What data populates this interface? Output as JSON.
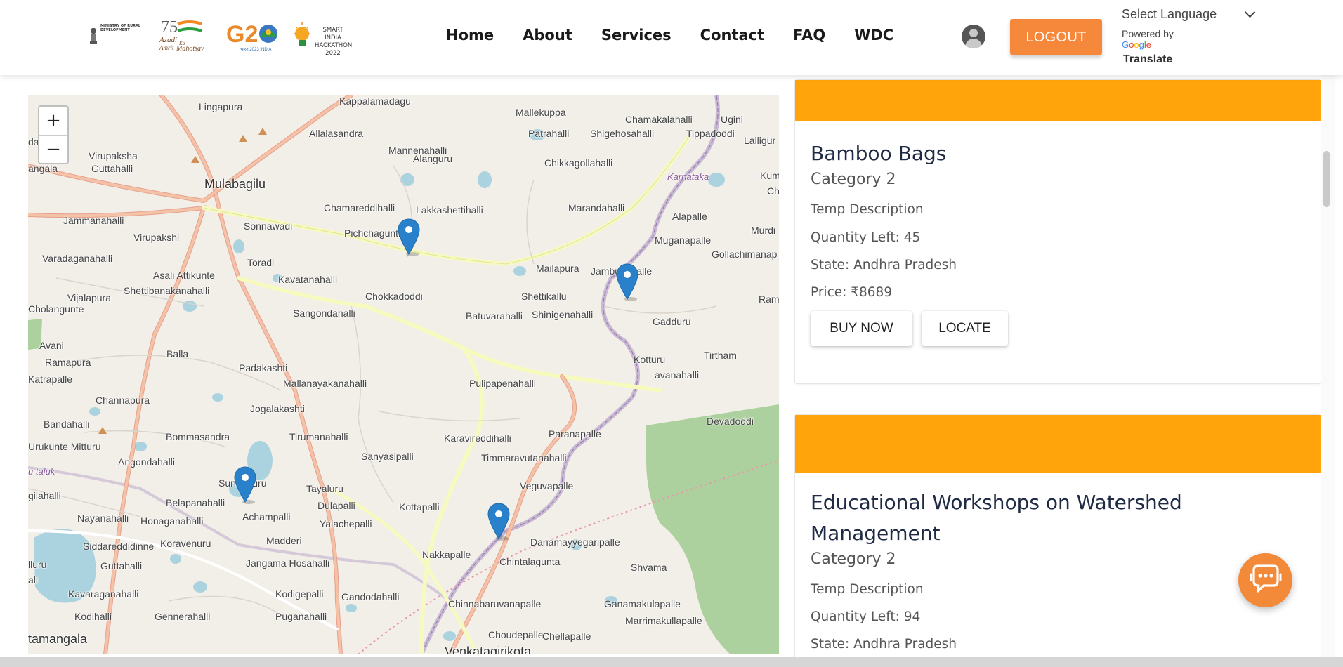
{
  "header": {
    "logos": {
      "mord": "MINISTRY OF RURAL DEVELOPMENT",
      "azadi": "Azadi Ka Amrit Mahotsav",
      "g20": "G20",
      "sih_line1": "SMART INDIA",
      "sih_line2": "HACKATHON",
      "sih_line3": "2022"
    },
    "nav": [
      "Home",
      "About",
      "Services",
      "Contact",
      "FAQ",
      "WDC"
    ],
    "logout_label": "LOGOUT",
    "language": {
      "select_label": "Select Language",
      "powered_by": "Powered by",
      "google": "Google",
      "translate": "Translate"
    }
  },
  "map": {
    "zoom_in": "+",
    "zoom_out": "−",
    "places": [
      "Lingapura",
      "Kappalamadagu",
      "Mallekuppa",
      "Chamakalahalli",
      "Ugini",
      "Patrahalli",
      "Shigehosahalli",
      "Tippadoddi",
      "Lalligur",
      "dagurki",
      "Allalasandra",
      "Mannenahalli",
      "Chikkagollahalli",
      "angala",
      "Virupaksha",
      "Guttahalli",
      "Mulabagilu",
      "Alanguru",
      "Karnataka",
      "Kum",
      "Ch",
      "Chamareddihalli",
      "Lakkashettihalli",
      "Marandahalli",
      "Alapalle",
      "Jammanahalli",
      "Sonnawadi",
      "Pichchagunthalli",
      "Virupakshi",
      "Murdi",
      "Muganapalle",
      "Gollachimanap",
      "Varadaganahalli",
      "Toradi",
      "Asali Attikunte",
      "Mailapura",
      "Jambunapalle",
      "Kavatanahalli",
      "Shettibanakanahalli",
      "Vijalapura",
      "Cholangunte",
      "Chokkadoddi",
      "Shettikallu",
      "Ram",
      "Sangondahalli",
      "Batuvarahalli",
      "Shinigenahalli",
      "Gadduru",
      "Avani",
      "Balla",
      "Tirtham",
      "Ramapura",
      "Kotturu",
      "Padakashti",
      "Katrapalle",
      "avanahalli",
      "Mallanayakanahalli",
      "Pulipapenahalli",
      "Channapura",
      "Jogalakashti",
      "Devadoddi",
      "Bandahalli",
      "Bommasandra",
      "Tirumanahalli",
      "Karavireddihalli",
      "Paranapalle",
      "Urukunte Mitturu",
      "Angondahalli",
      "Sanyasipalli",
      "Timmaravutanahalli",
      "u taluk",
      "Sunnaguru",
      "Tayaluru",
      "Veguvapalle",
      "gilahalli",
      "Belapanahalli",
      "Dulapalli",
      "Kottapalli",
      "Nayanahalli",
      "Honaganahalli",
      "Achampalli",
      "Yalachepalli",
      "Siddareddidinne",
      "Koravenuru",
      "Madderi",
      "Danamayyegaripalle",
      "lluru",
      "Guttahalli",
      "Jangama Hosahalli",
      "Nakkapalle",
      "Chintalagunta",
      "Shvama",
      "ali",
      "Kavaraganahalli",
      "Kodigepalli",
      "Gandodahalli",
      "Chinnabaruvanapalle",
      "Ganamakulapalle",
      "Kodihalli",
      "Puganahalli",
      "Marrimakullapalle",
      "Gennerahalli",
      "tamangala",
      "Choudepalle",
      "Chellapalle",
      "Venkatagirikota"
    ]
  },
  "products": [
    {
      "title": "Bamboo Bags",
      "category": "Category 2",
      "description": "Temp Description",
      "quantity": "Quantity Left: 45",
      "state": "State: Andhra Pradesh",
      "price": "Price: ₹8689",
      "buy_label": "BUY NOW",
      "locate_label": "LOCATE"
    },
    {
      "title": "Educational Workshops on Watershed Management",
      "category": "Category 2",
      "description": "Temp Description",
      "quantity": "Quantity Left: 94",
      "state": "State: Andhra Pradesh"
    }
  ],
  "colors": {
    "card_banner": "#ffa40a",
    "logout": "#f5883b",
    "chat": "#f28a3a",
    "marker": "#2a81cb"
  },
  "icons": {
    "avatar": "user-avatar-icon",
    "chat": "chat-support-icon",
    "marker": "map-marker-icon"
  }
}
